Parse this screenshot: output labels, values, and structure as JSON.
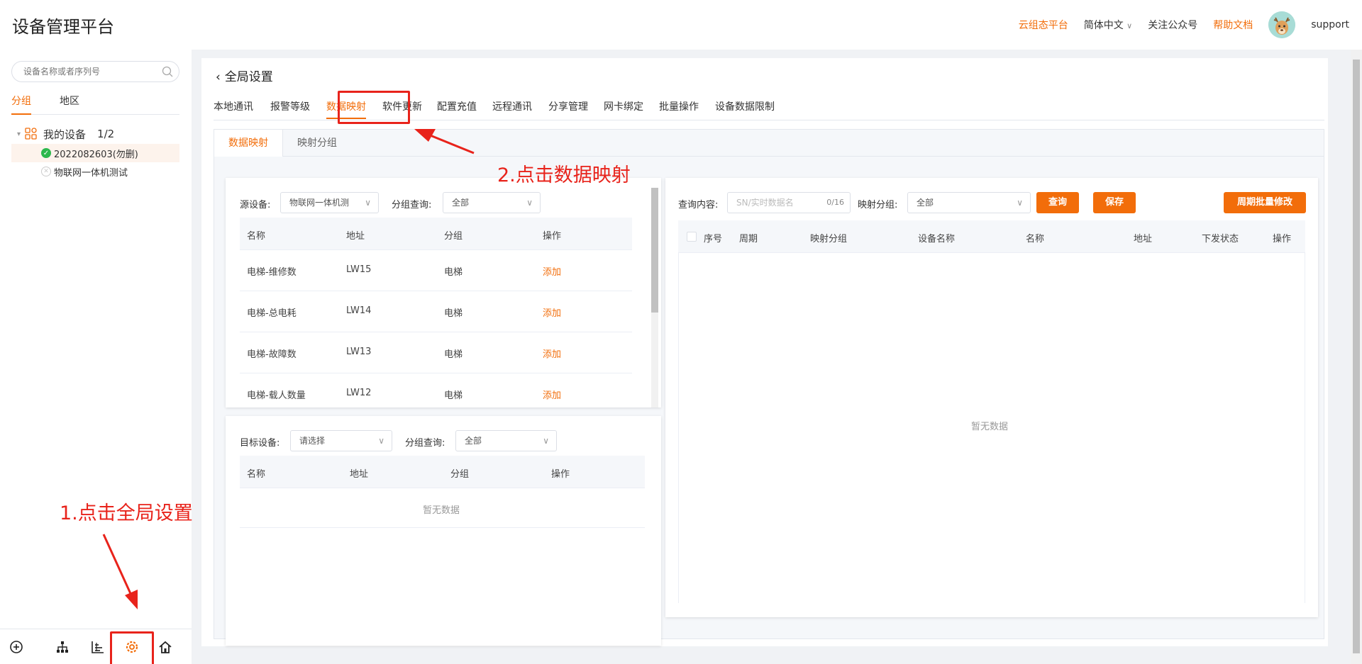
{
  "header": {
    "title": "设备管理平台",
    "links": [
      "云组态平台",
      "简体中文",
      "关注公众号",
      "帮助文档"
    ],
    "user": "support",
    "accent": "#f26d0a"
  },
  "sidebar": {
    "search_placeholder": "设备名称或者序列号",
    "tabs": [
      "分组",
      "地区"
    ],
    "tree_root": "我的设备",
    "tree_count": "1/2",
    "devices": [
      "2022082603(勿删)",
      "物联网一体机测试"
    ],
    "annotation": "1.点击全局设置",
    "bottom_icons": [
      "add-circle-icon",
      "org-tree-icon",
      "chart-list-icon",
      "global-settings-icon",
      "home-icon"
    ]
  },
  "main": {
    "title": "全局设置",
    "tabs": [
      "本地通讯",
      "报警等级",
      "数据映射",
      "软件更新",
      "配置充值",
      "远程通讯",
      "分享管理",
      "网卡绑定",
      "批量操作",
      "设备数据限制"
    ],
    "annotation": "2.点击数据映射",
    "sub_tabs": [
      "数据映射",
      "映射分组"
    ],
    "source": {
      "label": "源设备:",
      "value": "物联网一体机测",
      "group_label": "分组查询:",
      "group_value": "全部",
      "columns": [
        "名称",
        "地址",
        "分组",
        "操作"
      ],
      "rows": [
        {
          "name": "电梯-维修数",
          "addr": "LW15",
          "group": "电梯",
          "op": "添加"
        },
        {
          "name": "电梯-总电耗",
          "addr": "LW14",
          "group": "电梯",
          "op": "添加"
        },
        {
          "name": "电梯-故障数",
          "addr": "LW13",
          "group": "电梯",
          "op": "添加"
        },
        {
          "name": "电梯-载人数量",
          "addr": "LW12",
          "group": "电梯",
          "op": "添加"
        }
      ]
    },
    "target": {
      "label": "目标设备:",
      "value": "请选择",
      "group_label": "分组查询:",
      "group_value": "全部",
      "columns": [
        "名称",
        "地址",
        "分组",
        "操作"
      ],
      "empty": "暂无数据"
    },
    "mapping": {
      "query_label": "查询内容:",
      "query_placeholder": "SN/实时数据名",
      "query_count": "0/16",
      "group_label": "映射分组:",
      "group_value": "全部",
      "btn_query": "查询",
      "btn_save": "保存",
      "btn_batch": "周期批量修改",
      "columns": [
        "序号",
        "周期",
        "映射分组",
        "设备名称",
        "名称",
        "地址",
        "下发状态",
        "操作"
      ],
      "empty": "暂无数据"
    }
  }
}
